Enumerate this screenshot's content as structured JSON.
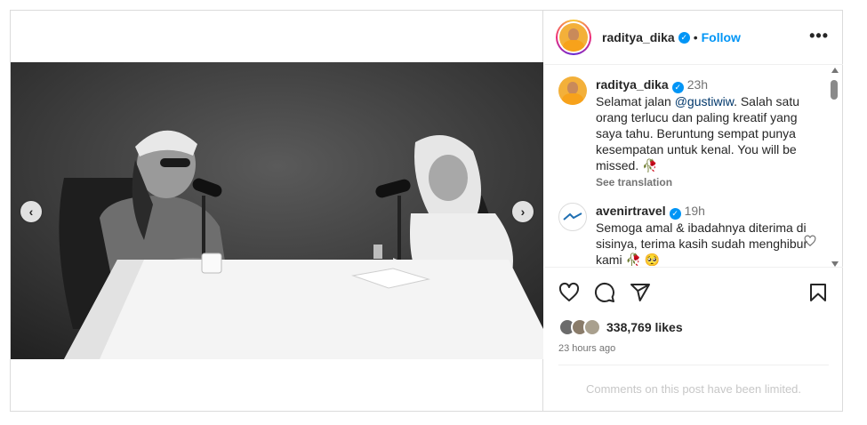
{
  "header": {
    "username": "raditya_dika",
    "separator": "•",
    "follow_label": "Follow",
    "more_label": "•••"
  },
  "media": {
    "prev_label": "‹",
    "next_label": "›"
  },
  "comments": [
    {
      "username": "raditya_dika",
      "time": "23h",
      "text_before": "Selamat jalan ",
      "mention": "@gustiwiw",
      "text_after": ". Salah satu orang terlucu dan paling kreatif yang saya tahu. Beruntung sempat punya kesempatan untuk kenal. You will be missed. 🥀",
      "see_translation": "See translation"
    },
    {
      "username": "avenirtravel",
      "time": "19h",
      "text": "Semoga amal & ibadahnya diterima di sisinya, terima kasih sudah menghibur kami 🥀 🥺"
    }
  ],
  "likes": {
    "count_label": "338,769 likes",
    "time_ago": "23 hours ago"
  },
  "footer": {
    "limited_text": "Comments on this post have been limited."
  },
  "icons": {
    "verified": "verified-badge",
    "like": "heart-icon",
    "comment": "comment-icon",
    "share": "share-icon",
    "save": "bookmark-icon"
  },
  "colors": {
    "accent": "#0095f6",
    "text": "#262626",
    "muted": "#737373",
    "border": "#dbdbdb"
  }
}
